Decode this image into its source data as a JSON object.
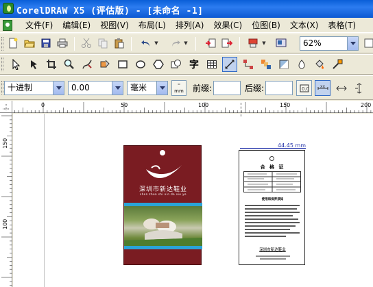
{
  "window": {
    "title": "CorelDRAW X5 (评估版) - [未命名 -1]"
  },
  "menu": [
    "文件(F)",
    "编辑(E)",
    "视图(V)",
    "布局(L)",
    "排列(A)",
    "效果(C)",
    "位图(B)",
    "文本(X)",
    "表格(T)"
  ],
  "toolbar_standard": {
    "buttons": [
      "new-icon",
      "open-icon",
      "save-icon",
      "print-icon",
      "cut-icon",
      "copy-icon",
      "paste-icon",
      "undo-icon",
      "redo-icon",
      "import-icon",
      "export-icon",
      "application-launcher-icon",
      "welcome-screen-icon"
    ],
    "zoom_value": "62%"
  },
  "toolbox": [
    "pick-tool-icon",
    "shape-tool-icon",
    "crop-tool-icon",
    "zoom-tool-icon",
    "freehand-tool-icon",
    "smart-fill-tool-icon",
    "rectangle-tool-icon",
    "ellipse-tool-icon",
    "polygon-tool-icon",
    "basic-shapes-icon",
    "text-tool-icon",
    "table-tool-icon",
    "dimension-tool-icon",
    "connector-tool-icon",
    "blend-tool-icon",
    "transparency-tool-icon",
    "eyedropper-tool-icon",
    "fill-tool-icon",
    "interactive-fill-icon"
  ],
  "property_bar": {
    "style_value": "十进制",
    "decimal_value": "0.00",
    "unit_value": "毫米",
    "prefix_label": "前缀:",
    "suffix_label": "后缀:"
  },
  "ruler": {
    "top_labels": [
      "0",
      "50",
      "100",
      "150",
      "200"
    ],
    "left_labels": [
      "150",
      "100"
    ]
  },
  "document": {
    "hangtag": {
      "company_name": "深圳市新达鞋业",
      "company_pinyin": "shen zhen shi xin da xie ye"
    },
    "certificate": {
      "dimension_text": "44.45 mm",
      "title": "合 格 证",
      "instructions_heading": "使用和保养须知",
      "footer": "深圳市新达鞋业"
    }
  },
  "colors": {
    "titlebar": "#0a5fd8",
    "hangtag_bg": "#7a1c22",
    "hangtag_stripe": "#2aa3d8",
    "dimension_blue": "#1f2fa8"
  }
}
